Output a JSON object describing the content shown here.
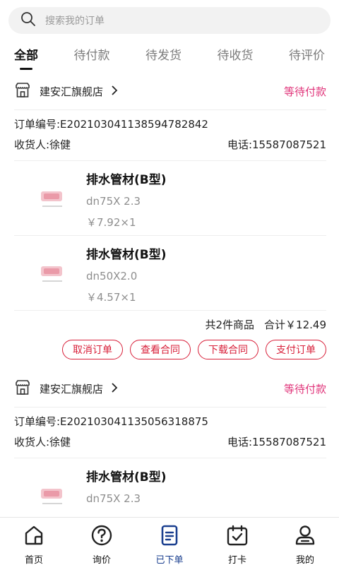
{
  "search": {
    "placeholder": "搜索我的订单"
  },
  "tabs": [
    "全部",
    "待付款",
    "待发货",
    "待收货",
    "待评价"
  ],
  "orders": [
    {
      "shop": "建安汇旗舰店",
      "status": "等待付款",
      "order_no": "订单编号:E20210304113859478284​2",
      "receiver": "收货人:徐健",
      "phone": "电话:15587087521",
      "items": [
        {
          "title": "排水管材(B型)",
          "spec": "dn75X 2.3",
          "price": "￥7.92×1"
        },
        {
          "title": "排水管材(B型)",
          "spec": "dn50X2.0",
          "price": "￥4.57×1"
        }
      ],
      "count": "共2件商品",
      "total": "合计￥12.49",
      "buttons": [
        "取消订单",
        "查看合同",
        "下载合同",
        "支付订单"
      ]
    },
    {
      "shop": "建安汇旗舰店",
      "status": "等待付款",
      "order_no": "订单编号:E20210304113505631887​5",
      "receiver": "收货人:徐健",
      "phone": "电话:15587087521",
      "items": [
        {
          "title": "排水管材(B型)",
          "spec": "dn75X 2.3",
          "price": ""
        }
      ]
    }
  ],
  "tabbar": [
    "首页",
    "询价",
    "已下单",
    "打卡",
    "我的"
  ],
  "colors": {
    "status": "#e0347a",
    "button": "#d8203a",
    "active_tab_icon": "#1a3f8f"
  }
}
